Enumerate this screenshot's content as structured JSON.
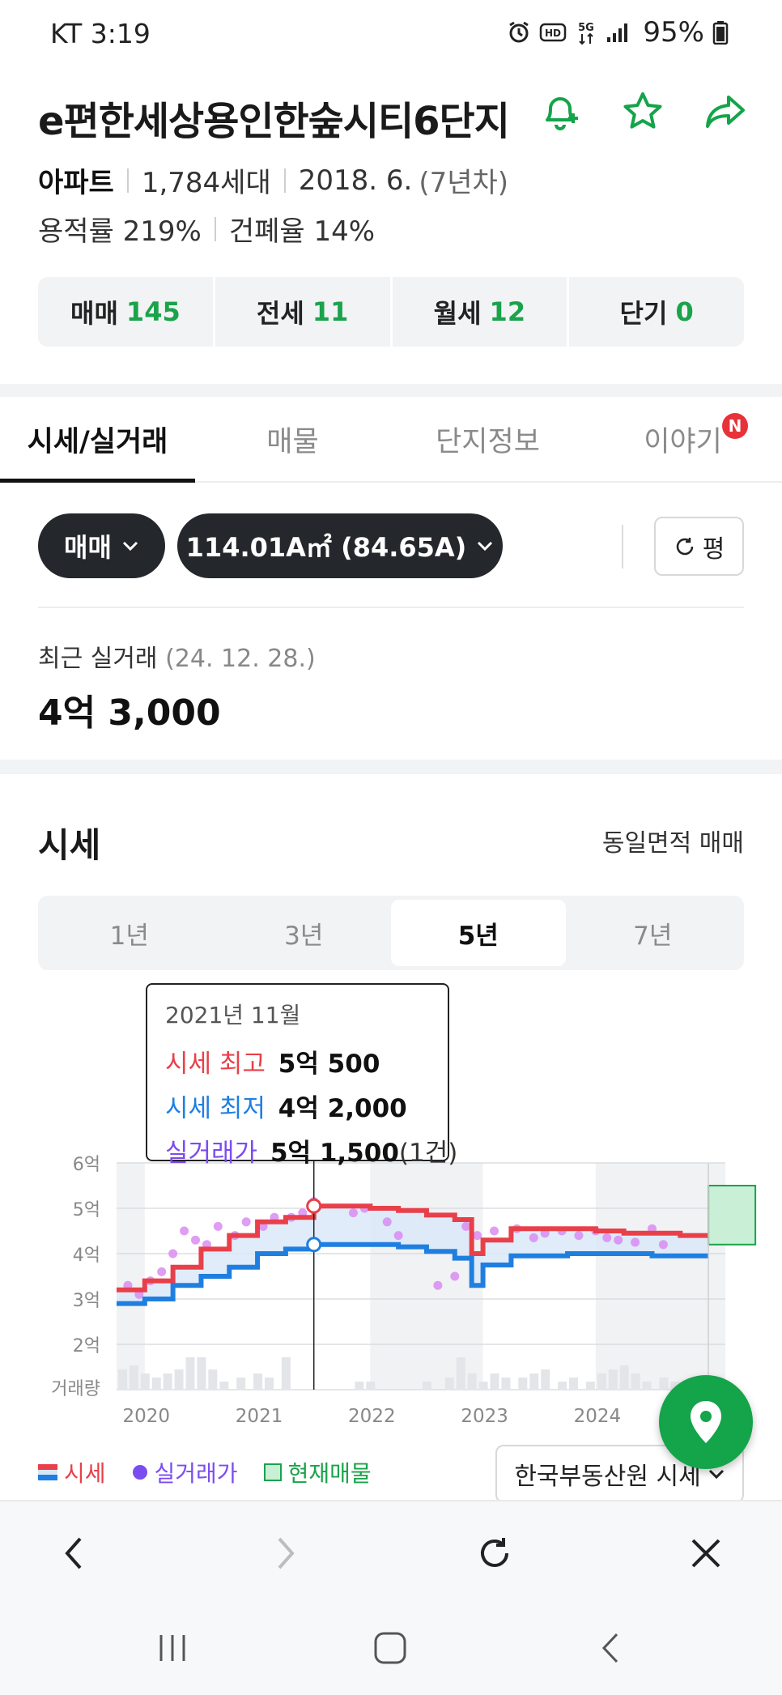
{
  "status_bar": {
    "carrier_time": "KT 3:19",
    "battery": "95%",
    "icons": [
      "alarm-icon",
      "hd-icon",
      "5g-icon",
      "signal-icon",
      "battery-icon"
    ]
  },
  "header": {
    "title": "e편한세상용인한숲시티6단지",
    "type": "아파트",
    "households": "1,784세대",
    "built": "2018. 6.",
    "age": "(7년차)",
    "floor_area_ratio": "용적률 219%",
    "building_coverage": "건폐율 14%",
    "actions": [
      "bell-plus-icon",
      "star-icon",
      "share-icon"
    ]
  },
  "trade_tabs": [
    {
      "label": "매매",
      "count": "145"
    },
    {
      "label": "전세",
      "count": "11"
    },
    {
      "label": "월세",
      "count": "12"
    },
    {
      "label": "단기",
      "count": "0"
    }
  ],
  "main_tabs": [
    {
      "label": "시세/실거래",
      "active": true
    },
    {
      "label": "매물"
    },
    {
      "label": "단지정보"
    },
    {
      "label": "이야기",
      "badge": "N"
    }
  ],
  "filters": {
    "trade_type": "매매",
    "area": "114.01A㎡ (84.65A)",
    "unit_toggle": "평"
  },
  "recent": {
    "label": "최근 실거래",
    "date": "(24. 12. 28.)",
    "price": "4억 3,000"
  },
  "market": {
    "title": "시세",
    "right_label": "동일면적 매매",
    "periods": [
      "1년",
      "3년",
      "5년",
      "7년"
    ],
    "active_period": "5년",
    "tooltip": {
      "date": "2021년 11월",
      "high_label": "시세 최고",
      "high_value": "5억 500",
      "low_label": "시세 최저",
      "low_value": "4억 2,000",
      "deal_label": "실거래가",
      "deal_value": "5억 1,500",
      "deal_count": "(1건)"
    },
    "legend": {
      "price": "시세",
      "deal": "실거래가",
      "listing": "현재매물"
    },
    "source": "한국부동산원 시세"
  },
  "colors": {
    "green": "#1aa34a",
    "red": "#e8404a",
    "blue": "#1f7fe0",
    "purple": "#7b4cf0",
    "dark": "#24272b"
  },
  "chart_data": {
    "type": "line",
    "y_ticks": [
      "6억",
      "5억",
      "4억",
      "3억",
      "2억",
      "거래량"
    ],
    "x_ticks": [
      "2020",
      "2021",
      "2022",
      "2023",
      "2024"
    ],
    "ylim": [
      2,
      6
    ],
    "x": [
      2019.75,
      2020.0,
      2020.25,
      2020.5,
      2020.75,
      2021.0,
      2021.25,
      2021.5,
      2021.75,
      2022.0,
      2022.25,
      2022.5,
      2022.75,
      2022.9,
      2023.0,
      2023.25,
      2023.5,
      2023.75,
      2024.0,
      2024.25,
      2024.5,
      2024.75,
      2025.0
    ],
    "series": [
      {
        "name": "시세 최고",
        "values": [
          3.2,
          3.4,
          3.7,
          4.1,
          4.4,
          4.7,
          4.8,
          5.05,
          5.05,
          5.0,
          4.95,
          4.85,
          4.75,
          4.0,
          4.3,
          4.55,
          4.55,
          4.55,
          4.5,
          4.45,
          4.45,
          4.4,
          4.4
        ]
      },
      {
        "name": "시세 최저",
        "values": [
          2.9,
          3.0,
          3.3,
          3.5,
          3.7,
          4.0,
          4.1,
          4.2,
          4.2,
          4.2,
          4.15,
          4.05,
          3.9,
          3.3,
          3.75,
          3.95,
          3.95,
          4.0,
          4.0,
          4.0,
          3.95,
          3.95,
          3.95
        ]
      }
    ],
    "deals": [
      [
        2019.85,
        3.3
      ],
      [
        2019.95,
        3.1
      ],
      [
        2020.05,
        3.4
      ],
      [
        2020.15,
        3.6
      ],
      [
        2020.25,
        4.0
      ],
      [
        2020.35,
        4.5
      ],
      [
        2020.45,
        4.3
      ],
      [
        2020.55,
        4.2
      ],
      [
        2020.65,
        4.6
      ],
      [
        2020.8,
        4.4
      ],
      [
        2020.9,
        4.7
      ],
      [
        2021.05,
        4.6
      ],
      [
        2021.15,
        4.8
      ],
      [
        2021.3,
        4.8
      ],
      [
        2021.4,
        4.9
      ],
      [
        2021.5,
        5.15
      ],
      [
        2021.85,
        4.9
      ],
      [
        2021.95,
        5.0
      ],
      [
        2022.15,
        4.7
      ],
      [
        2022.25,
        4.4
      ],
      [
        2022.6,
        3.3
      ],
      [
        2022.75,
        3.5
      ],
      [
        2022.85,
        4.6
      ],
      [
        2022.95,
        4.4
      ],
      [
        2023.1,
        4.5
      ],
      [
        2023.3,
        4.55
      ],
      [
        2023.45,
        4.35
      ],
      [
        2023.55,
        4.45
      ],
      [
        2023.7,
        4.5
      ],
      [
        2023.85,
        4.4
      ],
      [
        2024.0,
        4.5
      ],
      [
        2024.1,
        4.35
      ],
      [
        2024.2,
        4.3
      ],
      [
        2024.35,
        4.25
      ],
      [
        2024.5,
        4.55
      ],
      [
        2024.6,
        4.2
      ]
    ],
    "volume_x": [
      2019.8,
      2019.9,
      2020.0,
      2020.1,
      2020.2,
      2020.3,
      2020.4,
      2020.5,
      2020.6,
      2020.7,
      2020.85,
      2021.0,
      2021.1,
      2021.25,
      2021.9,
      2022.0,
      2022.5,
      2022.7,
      2022.8,
      2022.9,
      2023.0,
      2023.1,
      2023.2,
      2023.35,
      2023.45,
      2023.55,
      2023.7,
      2023.8,
      2023.95,
      2024.05,
      2024.15,
      2024.25,
      2024.35,
      2024.45,
      2024.6,
      2024.7
    ],
    "volume": [
      5,
      6,
      4,
      3,
      4,
      5,
      8,
      8,
      5,
      2,
      3,
      4,
      3,
      8,
      2,
      2,
      2,
      3,
      8,
      4,
      2,
      4,
      3,
      3,
      4,
      5,
      2,
      3,
      2,
      4,
      5,
      6,
      4,
      2,
      3,
      2
    ],
    "listing_range": [
      4.2,
      5.5
    ]
  }
}
